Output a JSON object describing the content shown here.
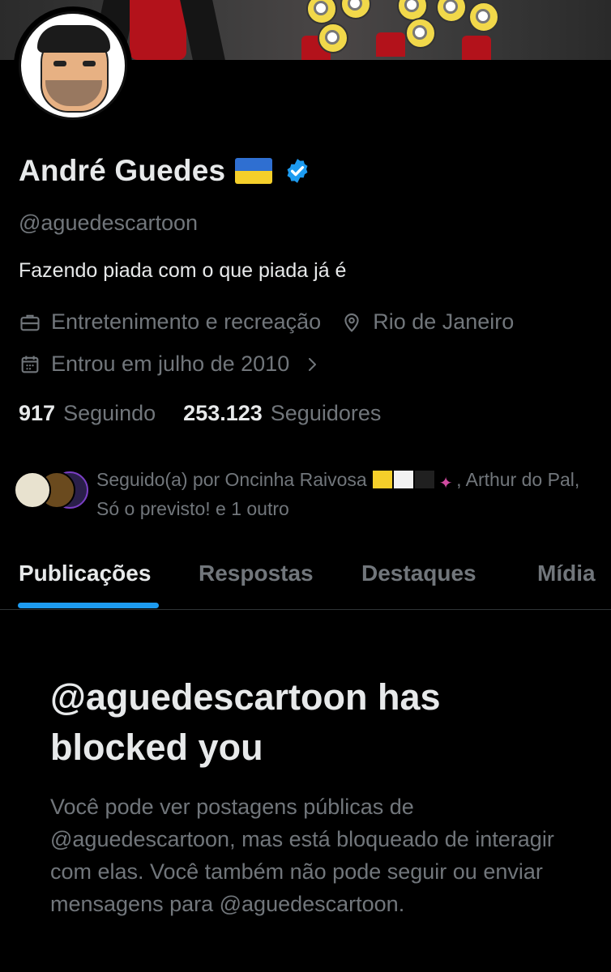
{
  "profile": {
    "name": "André Guedes",
    "handle": "@aguedescartoon",
    "bio": "Fazendo piada com o que piada já é",
    "category": "Entretenimento e recreação",
    "location": "Rio de Janeiro",
    "joined": "Entrou em julho de 2010",
    "following_count": "917",
    "following_label": "Seguindo",
    "followers_count": "253.123",
    "followers_label": "Seguidores"
  },
  "followed_by": {
    "prefix": "Seguido(a) por Oncinha Raivosa",
    "suffix": ", Arthur do Pal, Só o previsto! e 1 outro"
  },
  "tabs": [
    {
      "label": "Publicações",
      "active": true
    },
    {
      "label": "Respostas",
      "active": false
    },
    {
      "label": "Destaques",
      "active": false
    },
    {
      "label": "Mídia",
      "active": false
    }
  ],
  "blocked": {
    "title": "@aguedescartoon has blocked you",
    "body": "Você pode ver postagens públicas de @aguedescartoon, mas está bloqueado de interagir com elas. Você também não pode seguir ou enviar mensagens para @aguedescartoon."
  },
  "colors": {
    "accent": "#1d9bf0",
    "muted": "#71767b",
    "text": "#e7e9ea",
    "background": "#000000"
  },
  "icons": [
    "verified-badge-icon",
    "briefcase-icon",
    "location-pin-icon",
    "calendar-icon",
    "chevron-right-icon"
  ]
}
